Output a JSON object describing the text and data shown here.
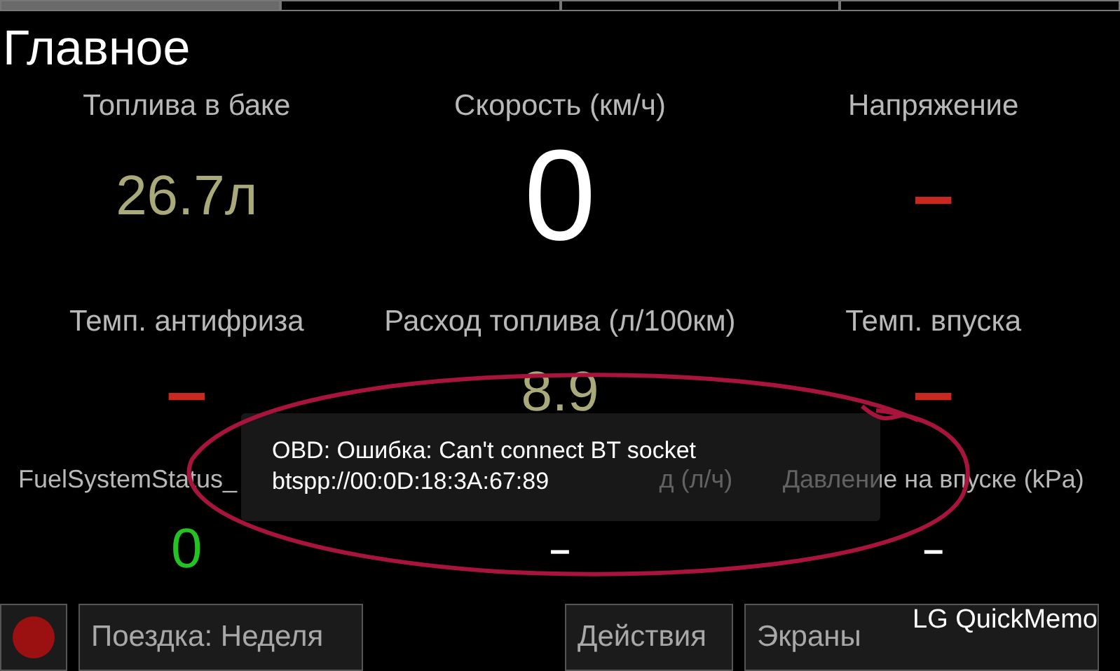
{
  "pager": [
    {
      "selected": true
    },
    {
      "selected": false
    },
    {
      "selected": false
    },
    {
      "selected": false
    }
  ],
  "title": "Главное",
  "gauges": [
    {
      "label": "Топлива в баке",
      "value": "26.7л",
      "kind": "normal",
      "color": "#a9a97a"
    },
    {
      "label": "Скорость (км/ч)",
      "value": "0",
      "kind": "large",
      "color": "#ffffff"
    },
    {
      "label": "Напряжение",
      "value": "–",
      "kind": "normal",
      "color": "#c8281e"
    },
    {
      "label": "Темп. антифриза",
      "value": "–",
      "kind": "normal",
      "color": "#c8281e"
    },
    {
      "label": "Расход топлива (л/100км)",
      "value": "8.9",
      "kind": "normal",
      "color": "#a9a97a"
    },
    {
      "label": "Темп. впуска",
      "value": "–",
      "kind": "normal",
      "color": "#c8281e"
    },
    {
      "label": "FuelSystemStatus_",
      "value": "0",
      "kind": "normal",
      "color": "#22c322"
    },
    {
      "label": "д (л/ч)",
      "value": "–",
      "kind": "small",
      "color": "#ffffff"
    },
    {
      "label": "Давление на впуске (kPa)",
      "value": "–",
      "kind": "small",
      "color": "#ffffff"
    }
  ],
  "toast": {
    "lines": [
      "OBD: Ошибка: Can't connect BT socket",
      "btspp://00:0D:18:3A:67:89"
    ]
  },
  "buttons": [
    {
      "kind": "record"
    },
    {
      "kind": "text",
      "label": "Поездка: Неделя"
    },
    {
      "kind": "text",
      "label": "Действия"
    },
    {
      "kind": "text",
      "label": "Экраны"
    }
  ],
  "overlay_label": "LG QuickMemo"
}
